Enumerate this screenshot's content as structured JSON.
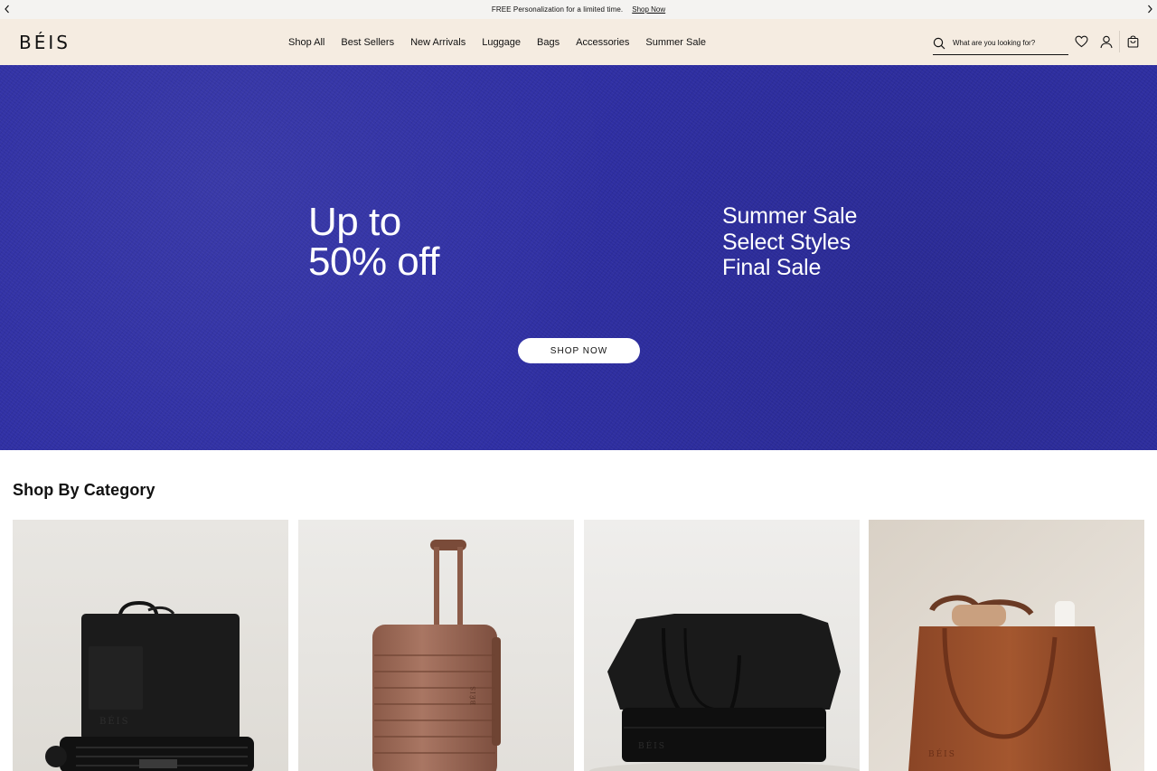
{
  "announcement": {
    "message": "FREE Personalization for a limited time.",
    "link": "Shop Now",
    "prev_icon": "chevron-left-icon",
    "next_icon": "chevron-right-icon"
  },
  "header": {
    "logo": "BÉIS",
    "nav": [
      "Shop All",
      "Best Sellers",
      "New Arrivals",
      "Luggage",
      "Bags",
      "Accessories",
      "Summer Sale"
    ],
    "search": {
      "placeholder": "What are you looking for?",
      "value": ""
    },
    "icons": [
      "search-icon",
      "heart-icon",
      "account-icon",
      "shopping-bag-icon"
    ]
  },
  "hero": {
    "headline_line1": "Up to",
    "headline_line2": "50% off",
    "side_line1": "Summer Sale",
    "side_line2": "Select Styles",
    "side_line3": "Final Sale",
    "cta": "SHOP NOW",
    "background_color": "#2f2fa4"
  },
  "category_section": {
    "title": "Shop By Category",
    "cards": [
      {
        "image": "black tote bag on black suitcase",
        "engraving": "BÉIS"
      },
      {
        "image": "maple carry-on roller luggage",
        "engraving": "BÉIS"
      },
      {
        "image": "black weekender bag",
        "engraving": "BÉIS"
      },
      {
        "image": "brown tote bag",
        "engraving": "BÉIS"
      }
    ]
  },
  "colors": {
    "announcement_bg": "#f4f3f1",
    "header_bg": "#f5ece1",
    "text": "#111111",
    "cta_bg": "#ffffff"
  }
}
